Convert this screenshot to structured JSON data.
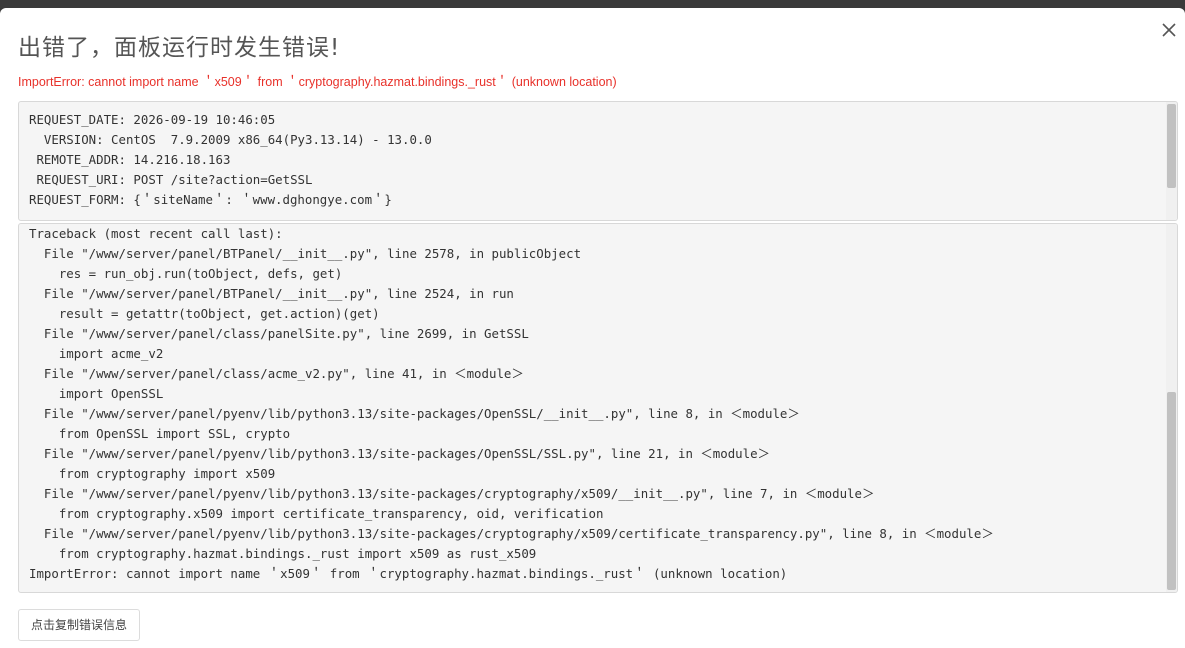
{
  "dialog": {
    "title": "出错了，面板运行时发生错误!",
    "error_message": "ImportError: cannot import name ＇x509＇ from ＇cryptography.hazmat.bindings._rust＇ (unknown location)",
    "close_icon": "close-icon"
  },
  "request_info": [
    "REQUEST_DATE: 2026-09-19 10:46:05",
    "  VERSION: CentOS  7.9.2009 x86_64(Py3.13.14) - 13.0.0",
    " REMOTE_ADDR: 14.216.18.163",
    " REQUEST_URI: POST /site?action=GetSSL",
    "REQUEST_FORM: {＇siteName＇: ＇www.dghongye.com＇}"
  ],
  "traceback": [
    "Traceback (most recent call last):",
    "  File \"/www/server/panel/BTPanel/__init__.py\", line 2578, in publicObject",
    "    res = run_obj.run(toObject, defs, get)",
    "  File \"/www/server/panel/BTPanel/__init__.py\", line 2524, in run",
    "    result = getattr(toObject, get.action)(get)",
    "  File \"/www/server/panel/class/panelSite.py\", line 2699, in GetSSL",
    "    import acme_v2",
    "  File \"/www/server/panel/class/acme_v2.py\", line 41, in ＜module＞",
    "    import OpenSSL",
    "  File \"/www/server/panel/pyenv/lib/python3.13/site-packages/OpenSSL/__init__.py\", line 8, in ＜module＞",
    "    from OpenSSL import SSL, crypto",
    "  File \"/www/server/panel/pyenv/lib/python3.13/site-packages/OpenSSL/SSL.py\", line 21, in ＜module＞",
    "    from cryptography import x509",
    "  File \"/www/server/panel/pyenv/lib/python3.13/site-packages/cryptography/x509/__init__.py\", line 7, in ＜module＞",
    "    from cryptography.x509 import certificate_transparency, oid, verification",
    "  File \"/www/server/panel/pyenv/lib/python3.13/site-packages/cryptography/x509/certificate_transparency.py\", line 8, in ＜module＞",
    "    from cryptography.hazmat.bindings._rust import x509 as rust_x509",
    "ImportError: cannot import name ＇x509＇ from ＇cryptography.hazmat.bindings._rust＇ (unknown location)"
  ],
  "copy_button_label": "点击复制错误信息",
  "colors": {
    "error_text": "#e8312a",
    "title_text": "#555555",
    "code_background": "#f5f5f5"
  }
}
